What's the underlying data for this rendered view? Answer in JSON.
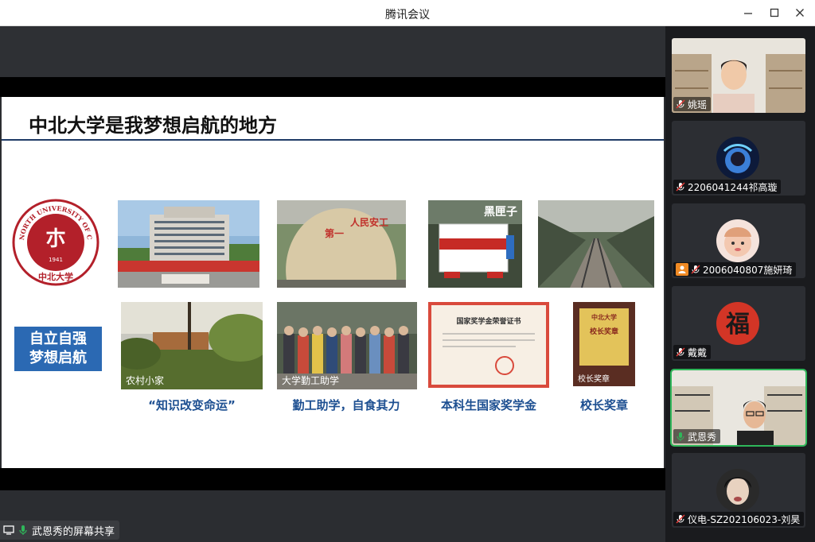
{
  "window": {
    "title": "腾讯会议",
    "minimize_icon": "minimize-icon",
    "maximize_icon": "maximize-icon",
    "close_icon": "close-icon"
  },
  "slide": {
    "title": "中北大学是我梦想启航的地方",
    "logo_text": "NORTH UNIVERSITY OF CHINA",
    "logo_year": "1941",
    "logo_name": "中北大学",
    "motto_line1": "自立自强",
    "motto_line2": "梦想启航",
    "photos_row1": [
      {
        "name": "campus-building"
      },
      {
        "name": "stone-monument"
      },
      {
        "name": "black-box",
        "overlay": "黑匣子"
      },
      {
        "name": "railway-track"
      }
    ],
    "photos_row2": [
      {
        "name": "village-home",
        "caption": "农村小家"
      },
      {
        "name": "work-study-group",
        "caption": "大学勤工助学"
      },
      {
        "name": "scholarship-certificate",
        "certificate_title": "国家奖学金荣誉证书"
      },
      {
        "name": "president-award",
        "caption": "校长奖章",
        "plaque_school": "中北大学",
        "plaque_title": "校长奖章"
      }
    ],
    "captions": [
      "“知识改变命运”",
      "勤工助学，自食其力",
      "本科生国家奖学金",
      "校长奖章"
    ]
  },
  "share_status": {
    "text": "武恩秀的屏幕共享",
    "icon": "screen-share-icon",
    "mic_icon": "mic-on-icon"
  },
  "participants": [
    {
      "name": "姚瑶",
      "video": true,
      "mic": "muted"
    },
    {
      "name": "2206041244祁高璇",
      "video": false,
      "mic": "muted"
    },
    {
      "name": "2006040807施妍琦",
      "video": false,
      "mic": "muted",
      "host": true
    },
    {
      "name": "戴戴",
      "video": false,
      "mic": "muted",
      "avatar_char": "福"
    },
    {
      "name": "武恩秀",
      "video": true,
      "mic": "on",
      "active": true
    },
    {
      "name": "仪电-SZ202106023-刘昊",
      "video": false,
      "mic": "muted"
    }
  ],
  "colors": {
    "accent_blue": "#2b69b3",
    "caption_blue": "#1d4f91",
    "university_red": "#b3202a",
    "active_speaker": "#2fb75a",
    "host_orange": "#f08a24"
  }
}
